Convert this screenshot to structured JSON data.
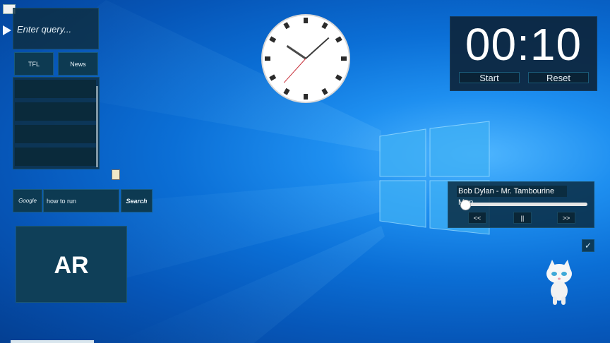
{
  "query_widget": {
    "placeholder": "Enter query..."
  },
  "shortcuts": [
    {
      "label": "TFL"
    },
    {
      "label": "News"
    }
  ],
  "search_widget": {
    "engine": "Google",
    "query": "how to run",
    "button": "Search"
  },
  "ar_tile": {
    "label": "AR"
  },
  "timer": {
    "display": "00:10",
    "start_label": "Start",
    "reset_label": "Reset"
  },
  "music_player": {
    "track": "Bob Dylan - Mr. Tambourine Man",
    "progress": 0.03,
    "prev_label": "<<",
    "pause_label": "||",
    "next_label": ">>"
  },
  "clock": {
    "hours": 10,
    "minutes": 8,
    "seconds": 22
  },
  "colors": {
    "panel": "#0e2d40",
    "accent": "#0d3a52",
    "timer_panel": "#0d253c"
  }
}
